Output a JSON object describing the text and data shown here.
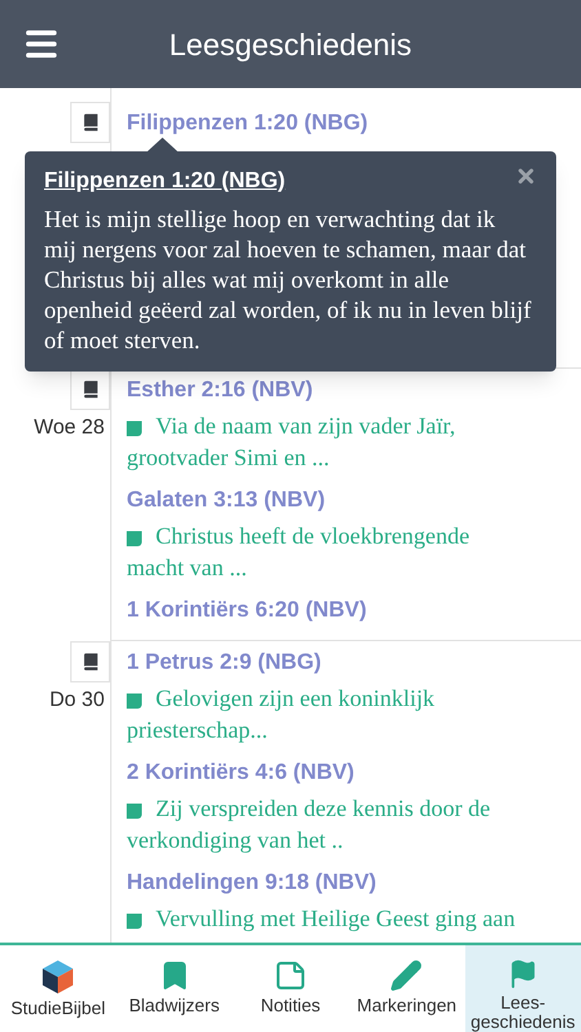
{
  "header": {
    "title": "Leesgeschiedenis"
  },
  "days": [
    {
      "entries": [
        {
          "title": "Filippenzen 1:20 (NBG)"
        }
      ]
    },
    {
      "date": "Woe 28",
      "entries": [
        {
          "title": "Esther 2:16 (NBV)",
          "note": "Via de naam van zijn vader Jaïr, grootvader Simi en ..."
        },
        {
          "title": "Galaten 3:13 (NBV)",
          "note": "Christus heeft de vloekbrengende macht van ..."
        },
        {
          "title": "1 Korintiërs 6:20 (NBV)"
        }
      ]
    },
    {
      "date": "Do 30",
      "entries": [
        {
          "title": "1 Petrus 2:9 (NBG)",
          "note": "Gelovigen zijn een koninklijk priesterschap..."
        },
        {
          "title": "2 Korintiërs 4:6 (NBV)",
          "note": "Zij verspreiden deze kennis door de verkondiging van het .."
        },
        {
          "title": "Handelingen 9:18 (NBV)",
          "note": "Vervulling met Heilige Geest ging aan"
        }
      ]
    }
  ],
  "tooltip": {
    "title": "Filippenzen 1:20 (NBG)",
    "text": "Het is mijn stellige hoop en verwachting dat ik mij nergens voor zal hoeven te schamen, maar dat Christus bij alles wat mij overkomt in alle openheid geëerd zal worden, of ik nu in leven blijf of moet sterven."
  },
  "tabs": [
    {
      "kind": "cube",
      "label": "StudieBijbel",
      "selected": false
    },
    {
      "kind": "bookmark",
      "label": "Bladwijzers",
      "selected": false
    },
    {
      "kind": "note",
      "label": "Notities",
      "selected": false
    },
    {
      "kind": "pencil",
      "label": "Markeringen",
      "selected": false
    },
    {
      "kind": "flag",
      "label": "Lees-geschiedenis",
      "selected": true
    }
  ]
}
